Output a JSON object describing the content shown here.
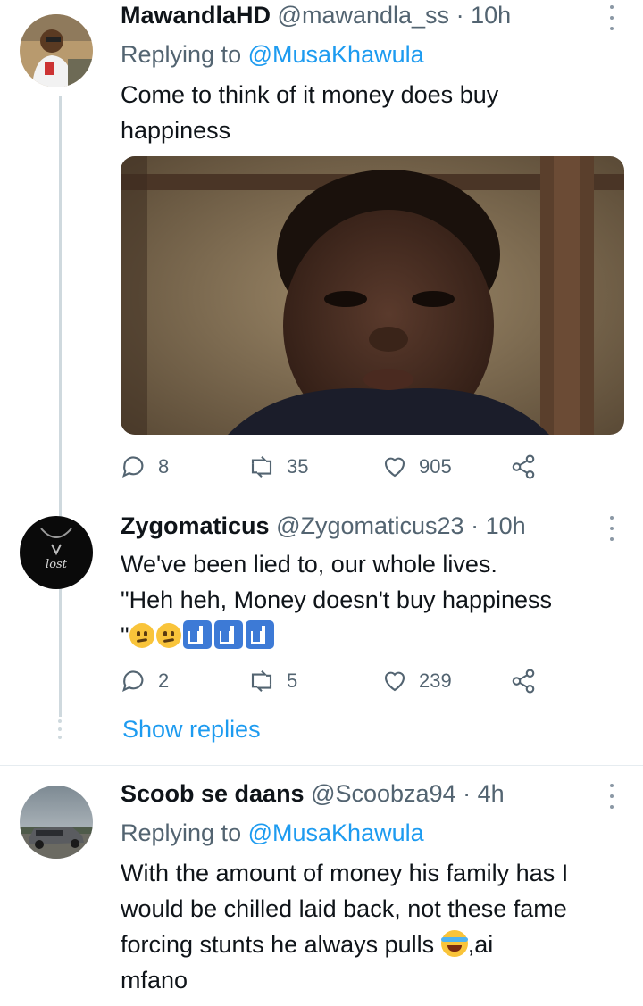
{
  "tweets": [
    {
      "name": "MawandlaHD",
      "handle": "@mawandla_ss",
      "separator": "·",
      "time": "10h",
      "replying_label": "Replying to",
      "replying_to": "@MusaKhawula",
      "text_line1": "Come to think of it money does buy",
      "text_line2": "happiness",
      "replies": "8",
      "retweets": "35",
      "likes": "905"
    },
    {
      "name": "Zygomaticus",
      "handle": "@Zygomaticus23",
      "separator": "·",
      "time": "10h",
      "text_line1": "We've been lied to, our whole lives.",
      "text_line2": "\"Heh heh, Money doesn't buy happiness",
      "text_line3_quote": "\"",
      "replies": "2",
      "retweets": "5",
      "likes": "239",
      "show_replies": "Show replies"
    },
    {
      "name": "Scoob se daans",
      "handle": "@Scoobza94",
      "separator": "·",
      "time": "4h",
      "replying_label": "Replying to",
      "replying_to": "@MusaKhawula",
      "text_line1": "With the amount of money his family has I",
      "text_line2": "would be chilled laid back, not these fame",
      "text_line3a": "forcing stunts he always pulls ",
      "text_line3b": ",ai",
      "text_line4": "mfano"
    }
  ],
  "avatar_labels": {
    "zygomaticus_logo": "lost"
  },
  "icons": {
    "reply": "reply-icon",
    "retweet": "retweet-icon",
    "like": "heart-icon",
    "share": "share-icon",
    "more": "more-options-icon"
  },
  "colors": {
    "link": "#1d9bf0",
    "secondary": "#536471",
    "primary": "#0f1419",
    "thread_line": "#cfd9de"
  }
}
